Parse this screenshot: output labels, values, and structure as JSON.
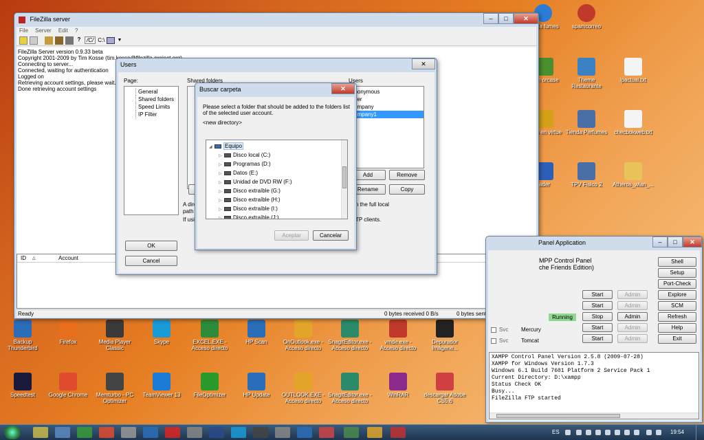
{
  "desktop": {
    "top_icons": [
      "spamcorreo"
    ],
    "right_icons": [
      {
        "label": "Theme Restaurante"
      },
      {
        "label": "ipactual.txt"
      },
      {
        "label": "Tienda Perfumes"
      },
      {
        "label": "checbokweb.txt"
      },
      {
        "label": "TPV Fisico 2"
      },
      {
        "label": "Atheros_wlan_..."
      },
      {
        "label": "tienda fumes"
      },
      {
        "label": "ogin orcase"
      },
      {
        "label": "onos en virtue"
      },
      {
        "label": "ader"
      }
    ],
    "bottom_row1": [
      {
        "label": "Backup Thunderbird"
      },
      {
        "label": "Firefox"
      },
      {
        "label": "Media Player Classic"
      },
      {
        "label": "Skype"
      },
      {
        "label": "EXCEL.EXE - Acceso directo"
      },
      {
        "label": "HP Scan"
      },
      {
        "label": "OnOutlook.exe - Acceso directo"
      },
      {
        "label": "SnagitEditor.exe - Acceso directo"
      },
      {
        "label": "vmde.exe - Acceso directo"
      },
      {
        "label": "Depurador Imágene..."
      }
    ],
    "bottom_row2": [
      {
        "label": "Speedtest"
      },
      {
        "label": "Google Chrome"
      },
      {
        "label": "Memturbo - PC Optimizer"
      },
      {
        "label": "TeamViewer 13"
      },
      {
        "label": "FileOptimizer"
      },
      {
        "label": "HP Update"
      },
      {
        "label": "OUTLOOK.EXE - Acceso directo"
      },
      {
        "label": "SnagitEditor.exe - Acceso directo"
      },
      {
        "label": "WinRAR"
      },
      {
        "label": "descargar Adobe CS5.6"
      }
    ]
  },
  "filezilla": {
    "title": "FileZilla server",
    "menu": [
      "File",
      "Server",
      "Edit",
      "?"
    ],
    "toolbar_path_labels": [
      "/C/",
      "C:\\"
    ],
    "log": [
      "FileZilla Server version 0.9.33 beta",
      "Copyright 2001-2009 by Tim Kosse (tim.kosse@filezilla-project.org)",
      "Connecting to server...",
      "Connected, waiting for authentication",
      "Logged on",
      "Retrieving account settings, please wait...",
      "Done retrieving account settings"
    ],
    "columns": {
      "id": "ID",
      "account": "Account"
    },
    "status_ready": "Ready",
    "status_received": "0 bytes received  0 B/s",
    "status_sent": "0 bytes sent  0 B/s"
  },
  "users_dialog": {
    "title": "Users",
    "page_label": "Page:",
    "pages": [
      "General",
      "Shared folders",
      "Speed Limits",
      "IP Filter"
    ],
    "shared_folders_label": "Shared folders",
    "users_label": "Users",
    "users": [
      "anonymous",
      "user",
      "company",
      "company1"
    ],
    "selected_user": 3,
    "add": "Add",
    "remove": "Remove",
    "rename": "Rename",
    "copy": "Copy",
    "hint_left1": "A dire",
    "hint_left2": "path",
    "hint_left3": "If usi",
    "hint_right1": "n the full local",
    "hint_right2": "TP clients.",
    "ok": "OK",
    "cancel": "Cancel"
  },
  "folder_dialog": {
    "title": "Buscar carpeta",
    "instructions": "Please select a folder that should be added to the folders list of the selected user account.",
    "new_dir": "<new directory>",
    "tree": [
      {
        "label": "Equipo",
        "level": 0,
        "root": true
      },
      {
        "label": "Disco local (C:)",
        "level": 1
      },
      {
        "label": "Programas (D:)",
        "level": 1
      },
      {
        "label": "Datos  (E:)",
        "level": 1
      },
      {
        "label": "Unidad de DVD RW (F:)",
        "level": 1
      },
      {
        "label": "Disco extraíble (G:)",
        "level": 1
      },
      {
        "label": "Disco extraíble (H:)",
        "level": 1
      },
      {
        "label": "Disco extraíble (I:)",
        "level": 1
      },
      {
        "label": "Disco extraíble (J:)",
        "level": 1
      }
    ],
    "accept": "Aceptar",
    "cancel": "Cancelar"
  },
  "xampp": {
    "title": "Panel Application",
    "header1": "MPP Control Panel",
    "header2": "che Friends Edition)",
    "side_buttons": [
      "Shell",
      "Setup",
      "Port-Check",
      "Explore",
      "SCM",
      "Refresh",
      "Help",
      "Exit"
    ],
    "rows": [
      {
        "status": "",
        "action": "Start",
        "admin": "Admin"
      },
      {
        "status": "",
        "action": "Start",
        "admin": "Admin"
      },
      {
        "status": "Running",
        "action": "Stop",
        "admin": "Admin"
      },
      {
        "status": "",
        "action": "Start",
        "admin": "Admin"
      },
      {
        "status": "",
        "action": "Start",
        "admin": "Admin"
      }
    ],
    "svc_rows": [
      {
        "svc": "Svc",
        "name": "Mercury"
      },
      {
        "svc": "Svc",
        "name": "Tomcat"
      }
    ],
    "console": [
      "XAMPP Control Panel Version 2.5.8 (2009-07-28)",
      "XAMPP for Windows Version 1.7.3",
      "Windows 6.1 Build 7601 Platform 2 Service Pack 1",
      "Current Directory: D:\\xampp",
      "Status Check OK",
      "Busy...",
      "FileZilla FTP started"
    ]
  },
  "taskbar": {
    "lang": "ES",
    "time": "19:54"
  }
}
